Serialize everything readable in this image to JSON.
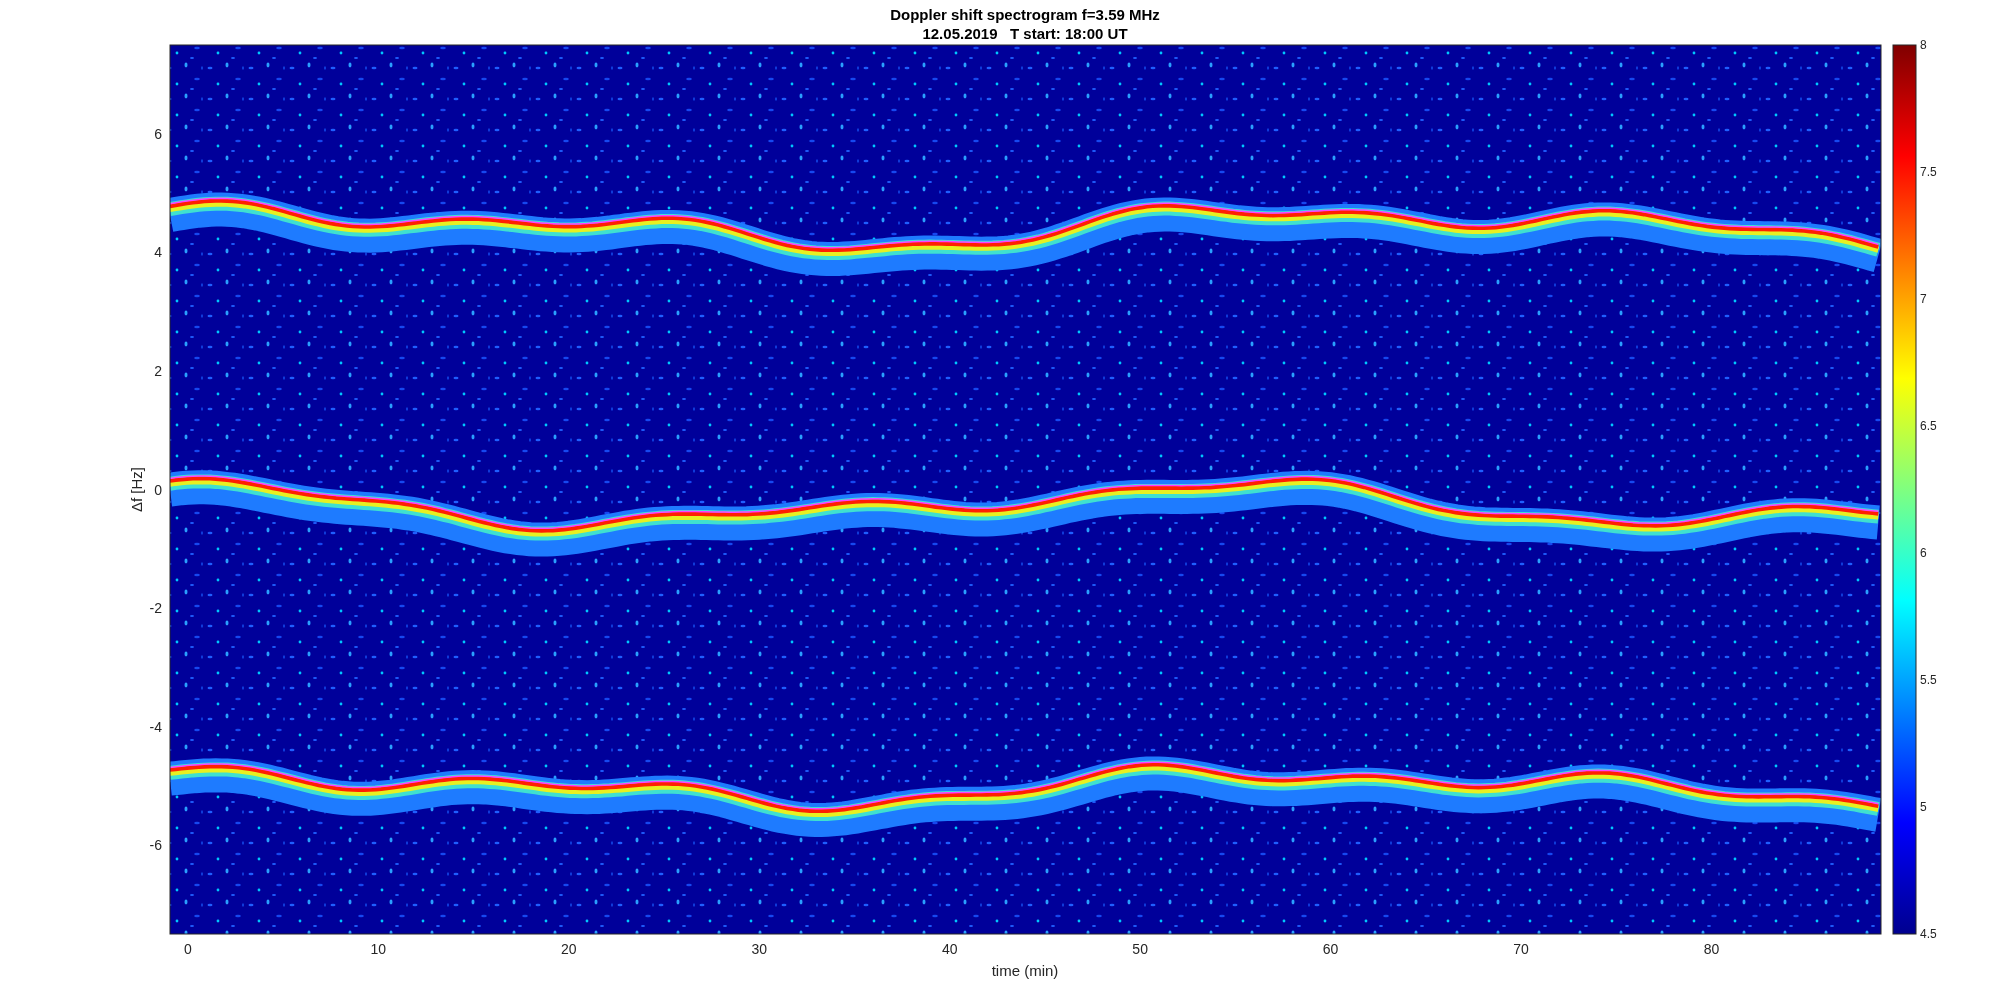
{
  "figure": {
    "title": [
      "Doppler shift spectrogram f=3.59 MHz",
      "12.05.2019   T start: 18:00 UT"
    ],
    "xlabel": "time (min)",
    "ylabel": "Δf [Hz]",
    "xticks": [
      "0",
      "10",
      "20",
      "30",
      "40",
      "50",
      "60",
      "70",
      "80"
    ],
    "yticks": [
      "6",
      "4",
      "2",
      "0",
      "-2",
      "-4",
      "-6"
    ],
    "colorbar_ticks": [
      "8",
      "7.5",
      "7",
      "6.5",
      "6",
      "5.5",
      "5",
      "4.5"
    ]
  }
}
